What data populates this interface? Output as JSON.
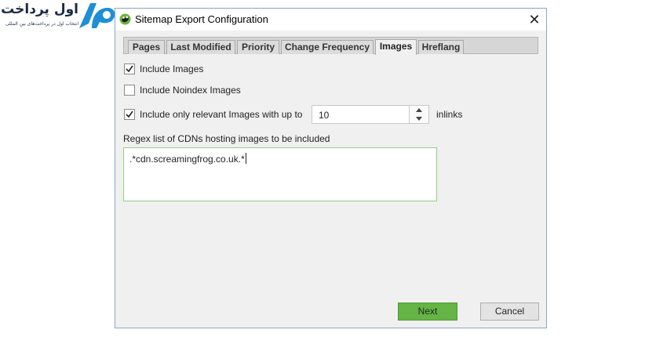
{
  "logo": {
    "persian_name": "اول پرداخت",
    "persian_tagline": "انتخاب اول در پرداخت‌های بین المللی",
    "brand_color": "#1e8fd6"
  },
  "window": {
    "title": "Sitemap Export Configuration",
    "close_glyph": "✕"
  },
  "tabs": [
    {
      "label": "Pages"
    },
    {
      "label": "Last Modified"
    },
    {
      "label": "Priority"
    },
    {
      "label": "Change Frequency"
    },
    {
      "label": "Images",
      "active": true
    },
    {
      "label": "Hreflang"
    }
  ],
  "options": {
    "include_images": {
      "label": "Include Images",
      "checked": true
    },
    "include_noindex_images": {
      "label": "Include Noindex Images",
      "checked": false
    },
    "relevant_images": {
      "label": "Include only relevant Images with up to",
      "checked": true,
      "value": "10",
      "suffix": "inlinks"
    }
  },
  "regex": {
    "label": "Regex list of CDNs hosting images to be included",
    "value": ".*cdn.screamingfrog.co.uk.*"
  },
  "buttons": {
    "next": "Next",
    "cancel": "Cancel"
  },
  "colors": {
    "next_button": "#64b446",
    "textarea_border": "#8fd07f",
    "dialog_border": "#8aa6c6"
  }
}
